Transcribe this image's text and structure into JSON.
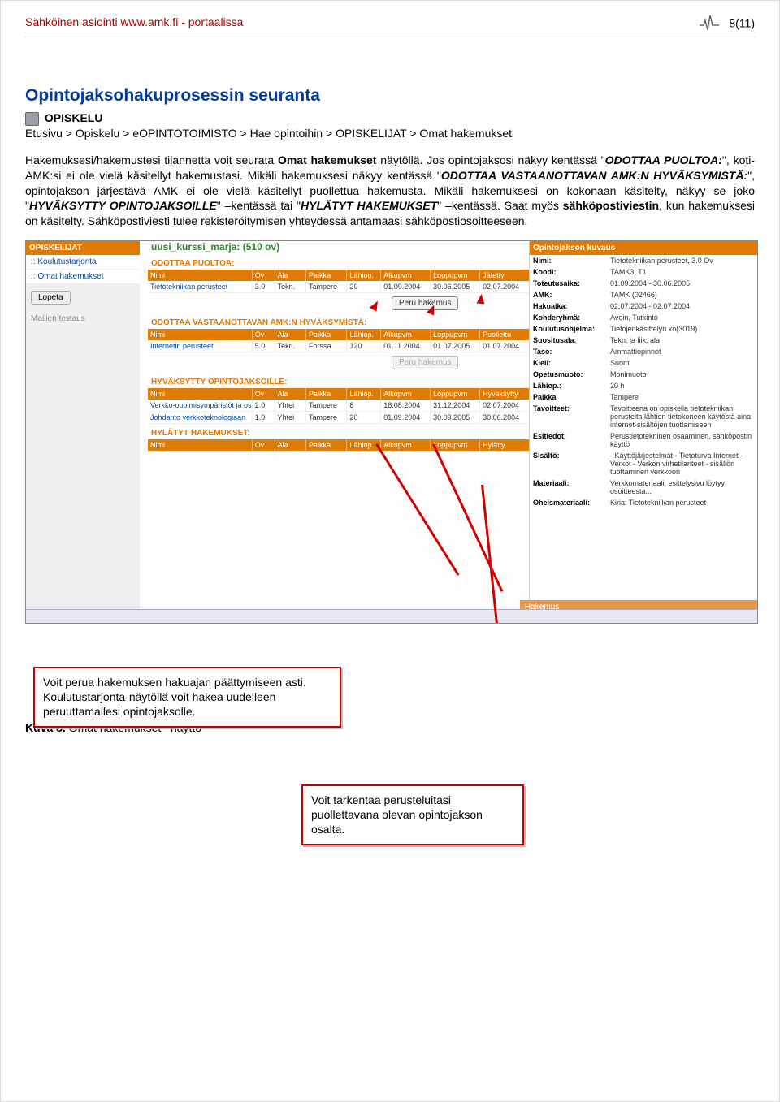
{
  "header": {
    "left": "Sähköinen asiointi www.amk.fi - portaalissa",
    "page": "8(11)"
  },
  "title": "Opintojaksohakuprosessin seuranta",
  "breadcrumb": {
    "icon_label": "OPISKELU",
    "path": "Etusivu > Opiskelu > eOPINTOTOIMISTO > Hae opintoihin > OPISKELIJAT > Omat hakemukset"
  },
  "body": {
    "p1a": "Hakemuksesi/hakemustesi tilannetta voit seurata ",
    "p1b": "Omat hakemukset",
    "p1c": " näytöllä. Jos opintojaksosi näkyy kentässä \"",
    "p1d": "ODOTTAA PUOLTOA:",
    "p1e": "\", koti-AMK:si ei ole vielä käsitellyt hakemustasi. Mikäli hakemuksesi näkyy kentässä \"",
    "p1f": "ODOTTAA VASTAANOTTAVAN AMK:N HYVÄKSYMISTÄ:",
    "p1g": "\", opintojakson järjestävä AMK ei ole vielä käsitellyt puollettua hakemusta. Mikäli hakemuksesi on kokonaan käsitelty, näkyy se joko \"",
    "p1h": "HYVÄKSYTTY OPINTOJAKSOILLE",
    "p1i": "\" –kentässä tai \"",
    "p1j": "HYLÄTYT HAKEMUKSET",
    "p1k": "\" –kentässä. Saat myös ",
    "p1l": "sähköpostiviestin",
    "p1m": ", kun hakemuksesi on käsitelty. Sähköpostiviesti tulee rekisteröitymisen yhteydessä antamaasi sähköpostiosoitteeseen."
  },
  "screenshot": {
    "greenname": "uusi_kurssi_marja: (510 ov)",
    "sidebar": {
      "title": "OPISKELIJAT",
      "items": [
        ":: Koulutustarjonta",
        ":: Omat hakemukset"
      ],
      "lopeta": "Lopeta",
      "mail": "Mailien testaus"
    },
    "sections": {
      "s1": {
        "title": "ODOTTAA PUOLTOA:",
        "cols": [
          "Nimi",
          "Ov",
          "Ala",
          "Paikka",
          "Lähiop.",
          "Alkupvm",
          "Loppupvm",
          "Jätetty"
        ],
        "row": [
          "Tietotekniikan perusteet",
          "3.0",
          "Tekn.",
          "Tampere",
          "20",
          "01.09.2004",
          "30.06.2005",
          "02.07.2004"
        ],
        "btn": "Peru hakemus"
      },
      "s2": {
        "title": "ODOTTAA VASTAANOTTAVAN AMK:N HYVÄKSYMISTÄ:",
        "cols": [
          "Nimi",
          "Ov",
          "Ala",
          "Paikka",
          "Lähiop.",
          "Alkupvm",
          "Loppupvm",
          "Puollettu"
        ],
        "row": [
          "Internetin perusteet",
          "5.0",
          "Tekn.",
          "Forssa",
          "120",
          "01.11.2004",
          "01.07.2005",
          "01.07.2004"
        ],
        "btn": "Peru hakemus"
      },
      "s3": {
        "title": "HYVÄKSYTTY OPINTOJAKSOILLE:",
        "cols": [
          "Nimi",
          "Ov",
          "Ala",
          "Paikka",
          "Lähiop.",
          "Alkupvm",
          "Loppupvm",
          "Hyväksytty"
        ],
        "rows": [
          [
            "Verkko-oppimisympäristöt ja osaamisportaalit",
            "2.0",
            "Yhtei",
            "Tampere",
            "8",
            "18.08.2004",
            "31.12.2004",
            "02.07.2004"
          ],
          [
            "Johdanto verkkoteknologiaan",
            "1.0",
            "Yhtei",
            "Tampere",
            "20",
            "01.09.2004",
            "30.09.2005",
            "30.06.2004"
          ]
        ]
      },
      "s4": {
        "title": "HYLÄTYT HAKEMUKSET:",
        "cols": [
          "Nimi",
          "Ov",
          "Ala",
          "Paikka",
          "Lähiop.",
          "Alkupvm",
          "Loppupvm",
          "Hylätty"
        ]
      }
    },
    "detail": {
      "title": "Opintojakson kuvaus",
      "rows": [
        [
          "Nimi:",
          "Tietotekniikan perusteet, 3.0 Ov"
        ],
        [
          "Koodi:",
          "TAMK3, T1"
        ],
        [
          "Toteutusaika:",
          "01.09.2004 - 30.06.2005"
        ],
        [
          "AMK:",
          "TAMK (02466)"
        ],
        [
          "Hakuaika:",
          "02.07.2004 - 02.07.2004"
        ],
        [
          "Kohderyhmä:",
          "Avoin, Tutkinto"
        ],
        [
          "Koulutusohjelma:",
          "Tietojenkäsittelyn ko(3019)"
        ],
        [
          "Suositusala:",
          "Tekn. ja liik. ala"
        ],
        [
          "Taso:",
          "Ammattiopinnot"
        ],
        [
          "Kieli:",
          "Suomi"
        ],
        [
          "Opetusmuoto:",
          "Monimuoto"
        ],
        [
          "Lähiop.:",
          "20 h"
        ],
        [
          "Paikka",
          "Tampere"
        ],
        [
          "Tavoitteet:",
          "Tavoitteena on opiskella tietotekniikan perusteita lähtien tietokoneen käytöstä aina internet-sisältöjen tuottamiseen"
        ],
        [
          "Esitiedot:",
          "Perustietotekninen osaaminen, sähköpostin käyttö"
        ],
        [
          "Sisältö:",
          "- Käyttöjärjestelmät - Tietoturva Internet - Verkot - Verkon virhetilanteet - sisällön tuottaminen verkkoon"
        ],
        [
          "Materiaali:",
          "Verkkomateriaali, esittelysivu löytyy osoitteesta..."
        ],
        [
          "Oheismateriaali:",
          "Kiria: Tietotekniikan perusteet"
        ]
      ],
      "hakemus": "Hakemus"
    }
  },
  "callout1": "Voit perua hakemuksen hakuajan päättymiseen asti. Koulutustarjonta-näytöllä voit hakea uudelleen peruuttamallesi opintojaksolle.",
  "callout2": "Voit tarkentaa perusteluitasi puollettavana olevan opintojakson osalta.",
  "caption": {
    "a": "Kuva 8.",
    "b": " Omat hakemukset –näyttö"
  }
}
